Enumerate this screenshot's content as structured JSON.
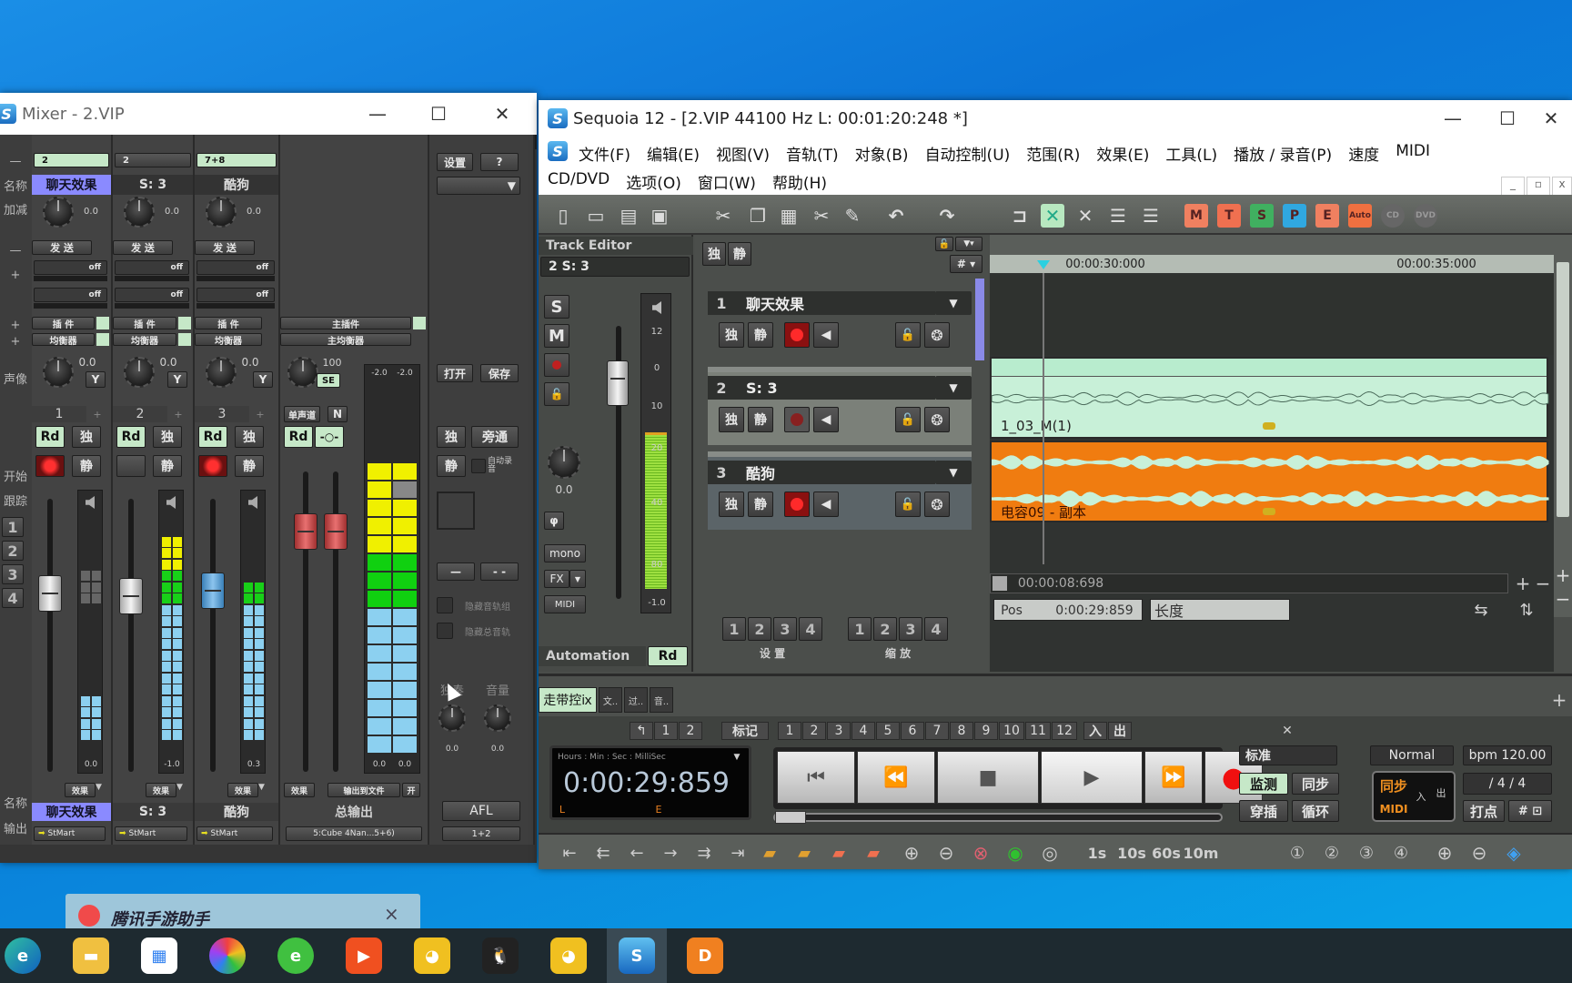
{
  "colors": {
    "accent_green": "#c6e8c8",
    "clip_green": "#c8f0d8",
    "clip_orange": "#f07c10",
    "record_red": "#ff2020",
    "name_highlight": "#8080ff"
  },
  "mixer": {
    "title": "Mixer - 2.VIP",
    "left_labels": [
      "—",
      "名称",
      "加减",
      "—",
      "+",
      "+",
      "+",
      "声像",
      "开始",
      "跟踪",
      "1",
      "2",
      "3",
      "4",
      "名称",
      "输出"
    ],
    "send_label": "发 送",
    "off": "off",
    "plugin_label": "插 件",
    "eq_label": "均衡器",
    "pan_y": "Y",
    "plus": "+",
    "rd": "Rd",
    "solo": "独",
    "mute": "静",
    "fx": "效果",
    "channels": [
      {
        "sel": "2",
        "name": "聊天效果",
        "gain": "0.0",
        "pan": "0.0",
        "num": "1",
        "rec": true,
        "vol": "0.0",
        "out": "StMart",
        "meter_level": 0.18,
        "fader": 0.72
      },
      {
        "sel": "2",
        "name": "S: 3",
        "gain": "0.0",
        "pan": "0.0",
        "num": "2",
        "rec": false,
        "vol": "-1.0",
        "out": "StMart",
        "meter_level": 0.9,
        "fader": 0.71
      },
      {
        "sel": "7+8",
        "name": "酷狗",
        "gain": "0.0",
        "pan": "0.0",
        "num": "3",
        "rec": true,
        "vol": "0.3",
        "out": "StMart",
        "meter_level": 0.68,
        "fader": 0.73
      }
    ],
    "master": {
      "plugin": "主插件",
      "eq": "主均衡器",
      "pan": "100",
      "se": "SE",
      "mono": "单声道",
      "n": "N",
      "rd": "Rd",
      "meter_top": [
        "-2.0",
        "-2.0"
      ],
      "meter_bottom": [
        "0.0",
        "0.0"
      ],
      "fx": "效果",
      "to_file": "输出到文件",
      "on": "开",
      "name": "总输出",
      "out": "5:Cube 4Nan...5+6)",
      "meter_level": 1.0
    },
    "right": {
      "settings": "设置",
      "help": "?",
      "open": "打开",
      "save": "保存",
      "solo": "独",
      "bypass": "旁通",
      "mute": "静",
      "auto_rec": "自动录音",
      "btn1": "—",
      "btn2": "- -",
      "hide_groups": "隐藏音轨组",
      "hide_master": "隐藏总音轨",
      "solo_knob": "独奏",
      "vol_knob": "音量",
      "solo_val": "0.0",
      "vol_val": "0.0",
      "afl": "AFL",
      "out": "1+2"
    }
  },
  "sequoia": {
    "title": "Sequoia 12 - [2.VIP   44100 Hz L: 00:01:20:248 *]",
    "menu_row1": [
      "文件(F)",
      "编辑(E)",
      "视图(V)",
      "音轨(T)",
      "对象(B)",
      "自动控制(U)",
      "范围(R)",
      "效果(E)",
      "工具(L)",
      "播放 / 录音(P)",
      "速度",
      "MIDI"
    ],
    "menu_row2": [
      "CD/DVD",
      "选项(O)",
      "窗口(W)",
      "帮助(H)"
    ],
    "toolbar_letters": [
      "M",
      "T",
      "S",
      "P",
      "E",
      "Auto",
      "CD",
      "DVD"
    ],
    "track_editor": {
      "title": "Track Editor",
      "selected": "2   S: 3",
      "s": "S",
      "m": "M",
      "knob_val": "0.0",
      "phase": "φ",
      "mono": "mono",
      "fx": "FX",
      "midi": "MIDI",
      "meter_scale": [
        "12",
        "0",
        "10",
        "20",
        "40",
        "80"
      ],
      "meter_val": "-1.0",
      "automation": "Automation",
      "rd": "Rd",
      "meter_level": 0.75
    },
    "solo": "独",
    "mute": "静",
    "tracks": [
      {
        "num": "1",
        "name": "聊天效果",
        "rec_active": true
      },
      {
        "num": "2",
        "name": "S: 3",
        "rec_active": false
      },
      {
        "num": "3",
        "name": "酷狗",
        "rec_active": true
      }
    ],
    "presets": [
      "1",
      "2",
      "3",
      "4"
    ],
    "presets_label": "设 置",
    "zoom_label": "缩 放",
    "ruler": [
      "00:00:30:000",
      "00:00:35:000"
    ],
    "clips": [
      {
        "name": "1_03_M(1)"
      },
      {
        "name": "电容09 - 副本"
      }
    ],
    "zoom_time": "00:00:08:698",
    "pos_label": "Pos",
    "pos_value": "0:00:29:859",
    "length_label": "长度",
    "transport": {
      "tabs": [
        "走带控ⅸ",
        "文..",
        "过..",
        "音.."
      ],
      "marker_prev": "↰",
      "markers_a": [
        "1",
        "2"
      ],
      "marker_label": "标记",
      "markers": [
        "1",
        "2",
        "3",
        "4",
        "5",
        "6",
        "7",
        "8",
        "9",
        "10",
        "11",
        "12"
      ],
      "in": "入",
      "out": "出",
      "time_format": "Hours : Min :  Sec : MilliSec",
      "time": "0:00:29:859",
      "l": "L",
      "e": "E",
      "mode": "标准",
      "monitor": "监测",
      "sync": "同步",
      "punch": "穿插",
      "loop": "循环",
      "normal": "Normal",
      "bpm": "bpm 120.00",
      "sync_box": "同步",
      "midi_box": "MIDI",
      "in_box": "入",
      "out_box": "出",
      "meter": "/    4 / 4",
      "tap": "打点",
      "grid": "# ⊡",
      "zoom_units": [
        "1s",
        "10s",
        "60s",
        "10m"
      ]
    }
  },
  "notification": {
    "title": "腾讯手游助手",
    "close": "×"
  },
  "taskbar": [
    "edge",
    "file-explorer",
    "store",
    "color-app",
    "ie-browser",
    "media-player",
    "game-helper",
    "qq",
    "game-helper-2",
    "sequoia",
    "douyu"
  ]
}
